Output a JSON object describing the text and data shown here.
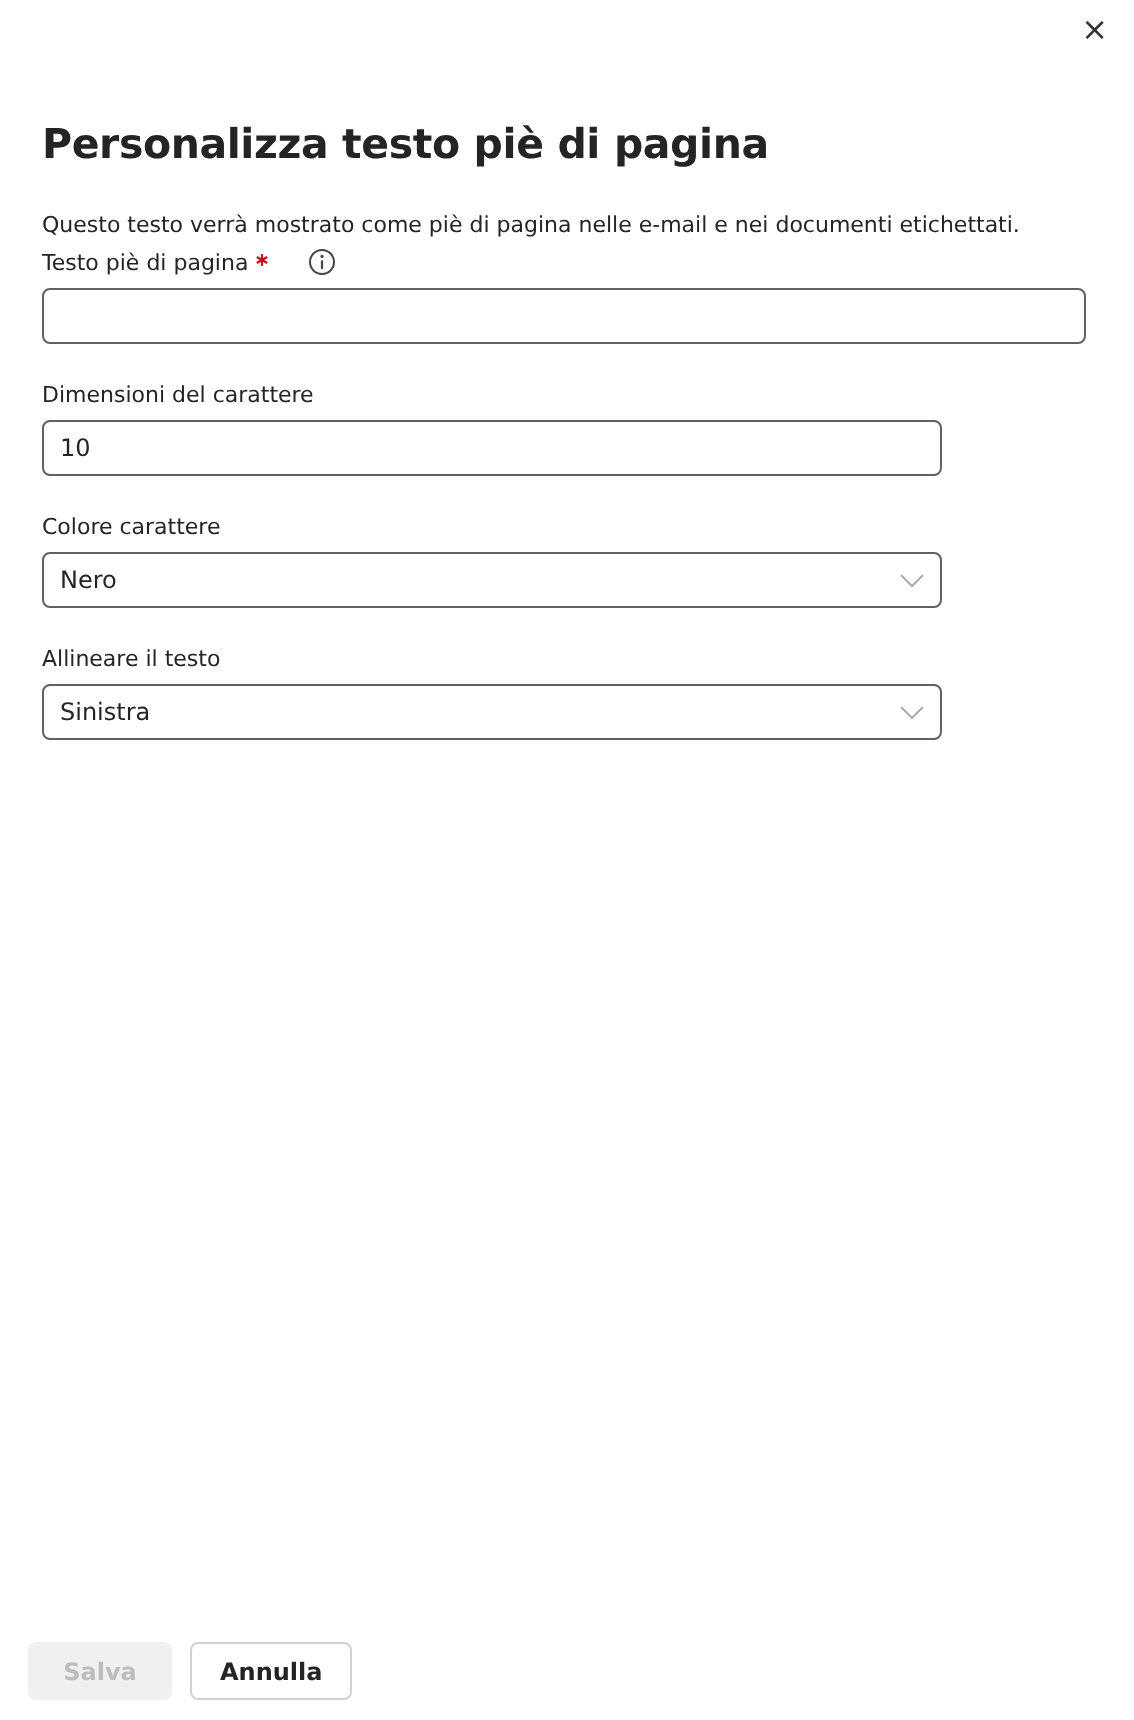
{
  "close_button": {
    "label": "×"
  },
  "title": "Personalizza testo piè di pagina",
  "description": "Questo testo verrà mostrato come piè di pagina nelle e-mail e nei documenti etichettati.",
  "fields": [
    {
      "kind": "text",
      "label": "Testo piè di pagina",
      "required": true,
      "info": true,
      "wide": true
    },
    {
      "kind": "text",
      "label": "Dimensioni del carattere",
      "required": false,
      "info": false,
      "value": "10",
      "wide": false
    },
    {
      "kind": "dropdown",
      "label": "Colore carattere",
      "required": false,
      "info": false,
      "value": "Nero",
      "wide": false
    },
    {
      "kind": "dropdown",
      "label": "Allineare il testo",
      "required": false,
      "info": false,
      "value": "Sinistra",
      "wide": false
    }
  ],
  "buttons": [
    {
      "label": "Salva",
      "disabled": true
    },
    {
      "label": "Annulla",
      "disabled": false
    }
  ]
}
